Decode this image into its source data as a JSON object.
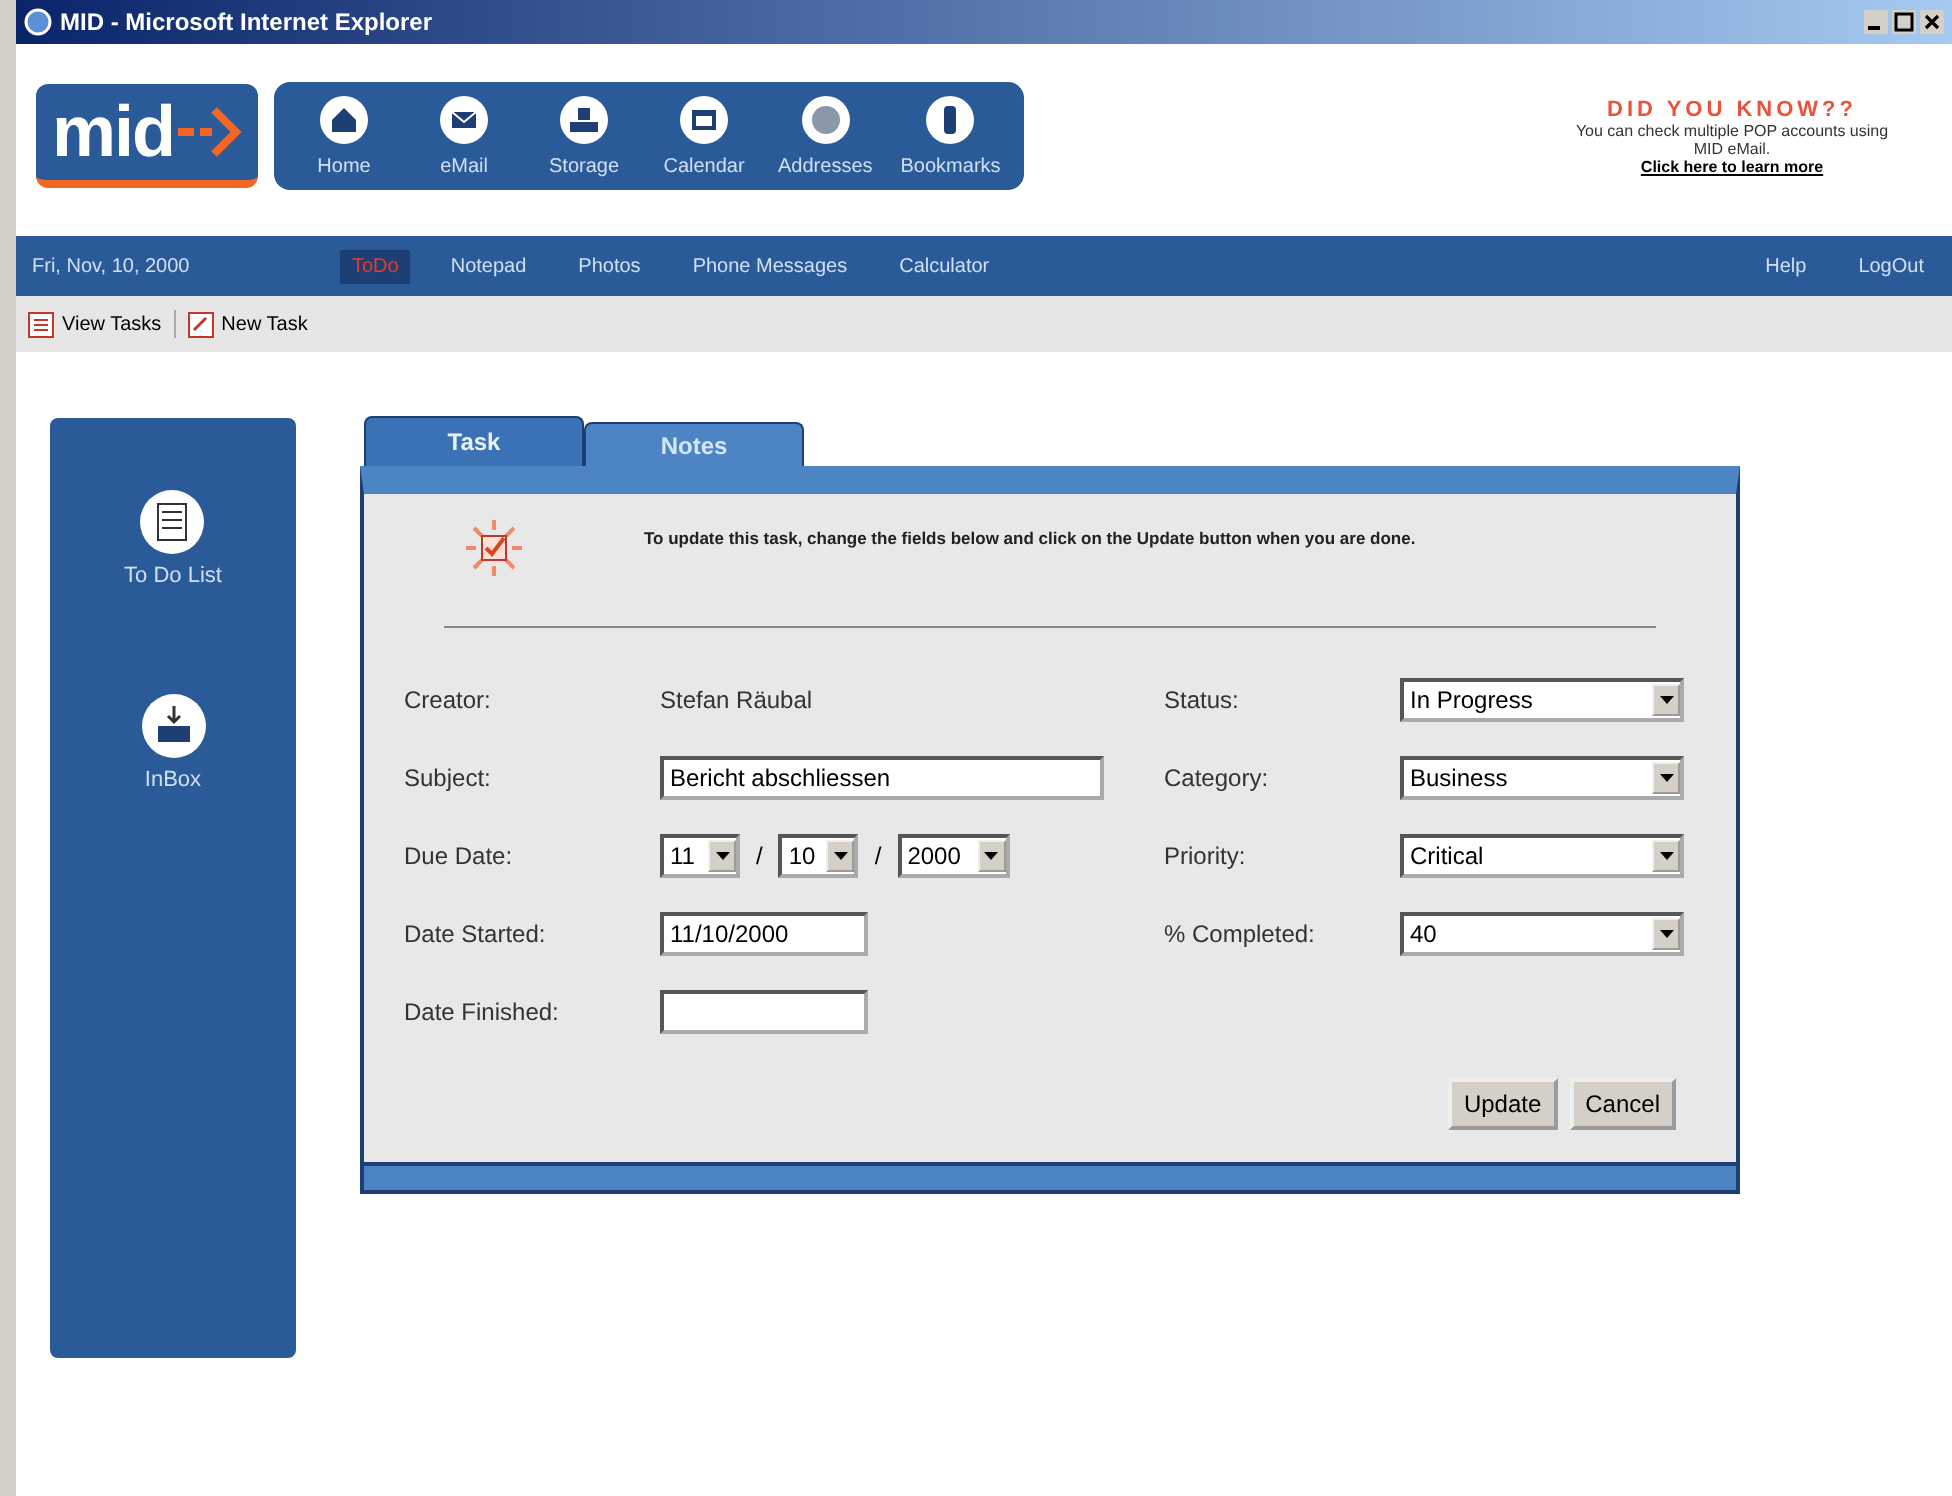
{
  "window": {
    "title": "MID - Microsoft Internet Explorer"
  },
  "header": {
    "logo": "mid",
    "nav": [
      {
        "label": "Home"
      },
      {
        "label": "eMail"
      },
      {
        "label": "Storage"
      },
      {
        "label": "Calendar"
      },
      {
        "label": "Addresses"
      },
      {
        "label": "Bookmarks"
      }
    ],
    "tip": {
      "title": "DID YOU KNOW??",
      "text": "You can check multiple POP accounts using MID eMail.",
      "link": "Click here to learn more"
    }
  },
  "menubar": {
    "date": "Fri, Nov, 10, 2000",
    "items": [
      {
        "label": "ToDo",
        "selected": true
      },
      {
        "label": "Notepad",
        "selected": false
      },
      {
        "label": "Photos",
        "selected": false
      },
      {
        "label": "Phone Messages",
        "selected": false
      },
      {
        "label": "Calculator",
        "selected": false
      }
    ],
    "right": [
      "Help",
      "LogOut"
    ]
  },
  "toolbar": [
    "View Tasks",
    "New Task"
  ],
  "sidebar": [
    {
      "label": "To Do List"
    },
    {
      "label": "InBox"
    }
  ],
  "tabs": [
    {
      "label": "Task",
      "selected": true
    },
    {
      "label": "Notes",
      "selected": false
    }
  ],
  "instructions": "To update this task, change the fields below and click on the Update button when you are done.",
  "left_fields": [
    {
      "kind": "text",
      "label": "Creator:",
      "value": "Stefan Räubal"
    },
    {
      "kind": "wide_input",
      "label": "Subject:",
      "value": "Bericht abschliessen"
    },
    {
      "kind": "date",
      "label": "Due Date:",
      "parts": [
        "11",
        "10",
        "2000"
      ],
      "separator": "/"
    },
    {
      "kind": "input",
      "label": "Date Started:",
      "value": "11/10/2000"
    },
    {
      "kind": "input",
      "label": "Date Finished:"
    }
  ],
  "right_fields": [
    {
      "label": "Status:",
      "value": "In Progress"
    },
    {
      "label": "Category:",
      "value": "Business"
    },
    {
      "label": "Priority:",
      "value": "Critical"
    },
    {
      "label": "% Completed:",
      "value": "40"
    }
  ],
  "buttons": [
    "Update",
    "Cancel"
  ]
}
